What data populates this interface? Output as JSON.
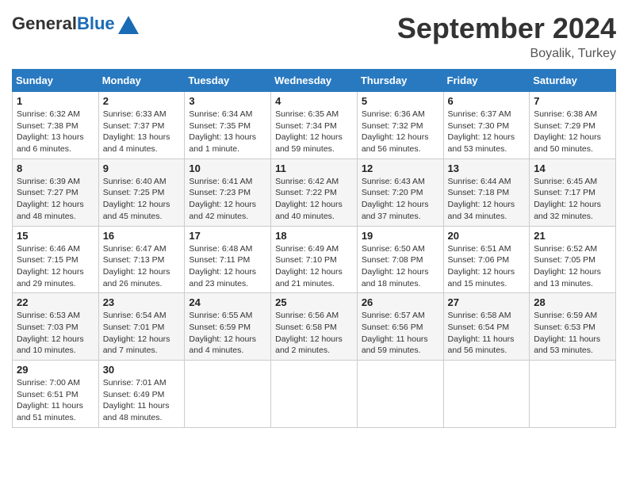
{
  "header": {
    "logo_general": "General",
    "logo_blue": "Blue",
    "month_title": "September 2024",
    "location": "Boyalik, Turkey"
  },
  "weekdays": [
    "Sunday",
    "Monday",
    "Tuesday",
    "Wednesday",
    "Thursday",
    "Friday",
    "Saturday"
  ],
  "weeks": [
    [
      {
        "day": "1",
        "info": "Sunrise: 6:32 AM\nSunset: 7:38 PM\nDaylight: 13 hours\nand 6 minutes."
      },
      {
        "day": "2",
        "info": "Sunrise: 6:33 AM\nSunset: 7:37 PM\nDaylight: 13 hours\nand 4 minutes."
      },
      {
        "day": "3",
        "info": "Sunrise: 6:34 AM\nSunset: 7:35 PM\nDaylight: 13 hours\nand 1 minute."
      },
      {
        "day": "4",
        "info": "Sunrise: 6:35 AM\nSunset: 7:34 PM\nDaylight: 12 hours\nand 59 minutes."
      },
      {
        "day": "5",
        "info": "Sunrise: 6:36 AM\nSunset: 7:32 PM\nDaylight: 12 hours\nand 56 minutes."
      },
      {
        "day": "6",
        "info": "Sunrise: 6:37 AM\nSunset: 7:30 PM\nDaylight: 12 hours\nand 53 minutes."
      },
      {
        "day": "7",
        "info": "Sunrise: 6:38 AM\nSunset: 7:29 PM\nDaylight: 12 hours\nand 50 minutes."
      }
    ],
    [
      {
        "day": "8",
        "info": "Sunrise: 6:39 AM\nSunset: 7:27 PM\nDaylight: 12 hours\nand 48 minutes."
      },
      {
        "day": "9",
        "info": "Sunrise: 6:40 AM\nSunset: 7:25 PM\nDaylight: 12 hours\nand 45 minutes."
      },
      {
        "day": "10",
        "info": "Sunrise: 6:41 AM\nSunset: 7:23 PM\nDaylight: 12 hours\nand 42 minutes."
      },
      {
        "day": "11",
        "info": "Sunrise: 6:42 AM\nSunset: 7:22 PM\nDaylight: 12 hours\nand 40 minutes."
      },
      {
        "day": "12",
        "info": "Sunrise: 6:43 AM\nSunset: 7:20 PM\nDaylight: 12 hours\nand 37 minutes."
      },
      {
        "day": "13",
        "info": "Sunrise: 6:44 AM\nSunset: 7:18 PM\nDaylight: 12 hours\nand 34 minutes."
      },
      {
        "day": "14",
        "info": "Sunrise: 6:45 AM\nSunset: 7:17 PM\nDaylight: 12 hours\nand 32 minutes."
      }
    ],
    [
      {
        "day": "15",
        "info": "Sunrise: 6:46 AM\nSunset: 7:15 PM\nDaylight: 12 hours\nand 29 minutes."
      },
      {
        "day": "16",
        "info": "Sunrise: 6:47 AM\nSunset: 7:13 PM\nDaylight: 12 hours\nand 26 minutes."
      },
      {
        "day": "17",
        "info": "Sunrise: 6:48 AM\nSunset: 7:11 PM\nDaylight: 12 hours\nand 23 minutes."
      },
      {
        "day": "18",
        "info": "Sunrise: 6:49 AM\nSunset: 7:10 PM\nDaylight: 12 hours\nand 21 minutes."
      },
      {
        "day": "19",
        "info": "Sunrise: 6:50 AM\nSunset: 7:08 PM\nDaylight: 12 hours\nand 18 minutes."
      },
      {
        "day": "20",
        "info": "Sunrise: 6:51 AM\nSunset: 7:06 PM\nDaylight: 12 hours\nand 15 minutes."
      },
      {
        "day": "21",
        "info": "Sunrise: 6:52 AM\nSunset: 7:05 PM\nDaylight: 12 hours\nand 13 minutes."
      }
    ],
    [
      {
        "day": "22",
        "info": "Sunrise: 6:53 AM\nSunset: 7:03 PM\nDaylight: 12 hours\nand 10 minutes."
      },
      {
        "day": "23",
        "info": "Sunrise: 6:54 AM\nSunset: 7:01 PM\nDaylight: 12 hours\nand 7 minutes."
      },
      {
        "day": "24",
        "info": "Sunrise: 6:55 AM\nSunset: 6:59 PM\nDaylight: 12 hours\nand 4 minutes."
      },
      {
        "day": "25",
        "info": "Sunrise: 6:56 AM\nSunset: 6:58 PM\nDaylight: 12 hours\nand 2 minutes."
      },
      {
        "day": "26",
        "info": "Sunrise: 6:57 AM\nSunset: 6:56 PM\nDaylight: 11 hours\nand 59 minutes."
      },
      {
        "day": "27",
        "info": "Sunrise: 6:58 AM\nSunset: 6:54 PM\nDaylight: 11 hours\nand 56 minutes."
      },
      {
        "day": "28",
        "info": "Sunrise: 6:59 AM\nSunset: 6:53 PM\nDaylight: 11 hours\nand 53 minutes."
      }
    ],
    [
      {
        "day": "29",
        "info": "Sunrise: 7:00 AM\nSunset: 6:51 PM\nDaylight: 11 hours\nand 51 minutes."
      },
      {
        "day": "30",
        "info": "Sunrise: 7:01 AM\nSunset: 6:49 PM\nDaylight: 11 hours\nand 48 minutes."
      },
      null,
      null,
      null,
      null,
      null
    ]
  ]
}
